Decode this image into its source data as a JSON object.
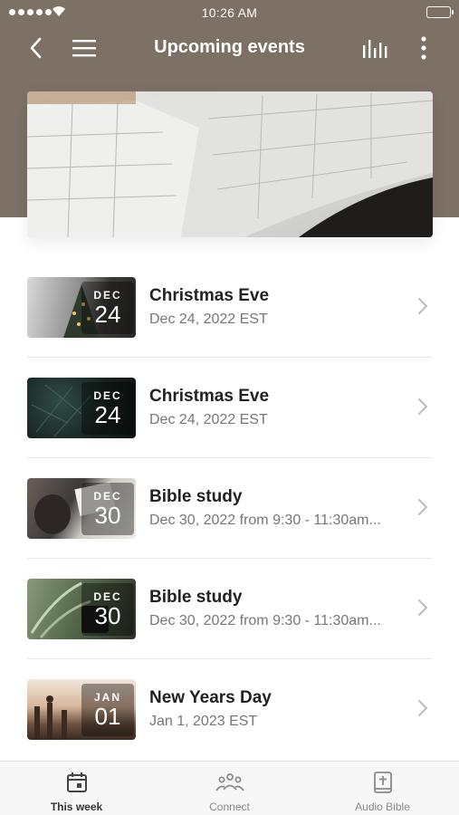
{
  "status_bar": {
    "time": "10:26 AM"
  },
  "header": {
    "title": "Upcoming events"
  },
  "events": [
    {
      "title": "Christmas Eve",
      "month": "DEC",
      "day": "24",
      "subtitle": "Dec 24, 2022 EST"
    },
    {
      "title": "Christmas Eve",
      "month": "DEC",
      "day": "24",
      "subtitle": "Dec 24, 2022 EST"
    },
    {
      "title": "Bible study",
      "month": "DEC",
      "day": "30",
      "subtitle": "Dec 30, 2022 from 9:30 - 11:30am..."
    },
    {
      "title": "Bible study",
      "month": "DEC",
      "day": "30",
      "subtitle": "Dec 30, 2022 from 9:30 - 11:30am..."
    },
    {
      "title": "New Years Day",
      "month": "JAN",
      "day": "01",
      "subtitle": "Jan 1, 2023 EST"
    }
  ],
  "tab_bar": {
    "tabs": [
      {
        "label": "This week",
        "icon": "calendar-icon",
        "active": true
      },
      {
        "label": "Connect",
        "icon": "people-icon",
        "active": false
      },
      {
        "label": "Audio Bible",
        "icon": "bible-icon",
        "active": false
      }
    ]
  },
  "colors": {
    "header_bg": "#7d7064",
    "tab_active": "#333333",
    "tab_inactive": "#8a8a8a"
  }
}
